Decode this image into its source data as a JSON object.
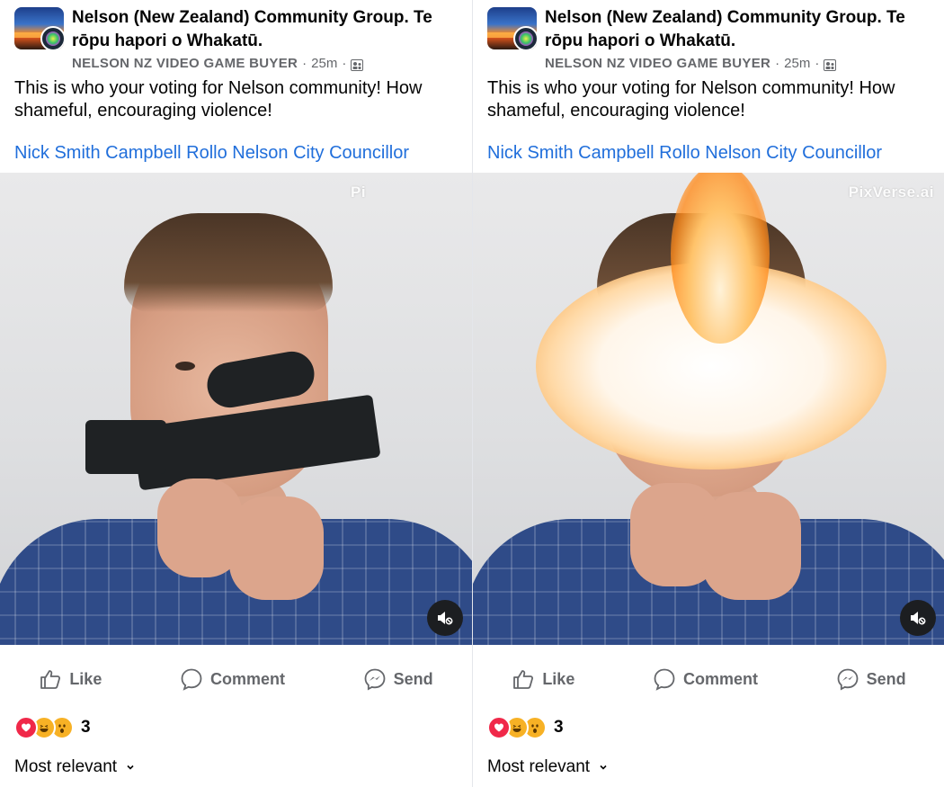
{
  "posts": [
    {
      "group_name": "Nelson (New Zealand) Community Group. Te rōpu hapori o Whakatū.",
      "author": "NELSON NZ VIDEO GAME BUYER",
      "time": "25m",
      "separator": "·",
      "audience_icon": "group-audience-icon",
      "body": "This is who your voting for Nelson community! How shameful, encouraging violence!",
      "link": "Nick Smith Campbell Rollo Nelson City Councillor",
      "video": {
        "watermark": "Pi",
        "frame": "aiming",
        "mute_icon": "sound-off-icon"
      },
      "actions": {
        "like": "Like",
        "comment": "Comment",
        "send": "Send"
      },
      "reactions": {
        "types": [
          "love",
          "haha",
          "wow"
        ],
        "count": "3"
      },
      "sort_label": "Most relevant"
    },
    {
      "group_name": "Nelson (New Zealand) Community Group. Te rōpu hapori o Whakatū.",
      "author": "NELSON NZ VIDEO GAME BUYER",
      "time": "25m",
      "separator": "·",
      "audience_icon": "group-audience-icon",
      "body": "This is who your voting for Nelson community! How shameful, encouraging violence!",
      "link": "Nick Smith Campbell Rollo Nelson City Councillor",
      "video": {
        "watermark": "PixVerse.ai",
        "frame": "firing",
        "mute_icon": "sound-off-icon"
      },
      "actions": {
        "like": "Like",
        "comment": "Comment",
        "send": "Send"
      },
      "reactions": {
        "types": [
          "love",
          "haha",
          "wow"
        ],
        "count": "3"
      },
      "sort_label": "Most relevant"
    }
  ],
  "colors": {
    "link": "#216fdb",
    "muted": "#65676b",
    "love": "#f02849",
    "haha": "#f7b125"
  }
}
